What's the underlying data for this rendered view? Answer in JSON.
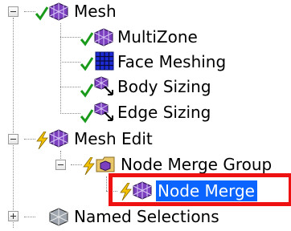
{
  "tree": {
    "mesh": {
      "label": "Mesh",
      "icon": "mesh-icon",
      "status": "check-icon",
      "expanded": true
    },
    "multizone": {
      "label": "MultiZone",
      "icon": "multizone-icon",
      "status": "check-icon"
    },
    "face_meshing": {
      "label": "Face Meshing",
      "icon": "face-meshing-icon",
      "status": "check-icon"
    },
    "body_sizing": {
      "label": "Body Sizing",
      "icon": "body-sizing-icon",
      "status": "check-icon"
    },
    "edge_sizing": {
      "label": "Edge Sizing",
      "icon": "edge-sizing-icon",
      "status": "check-icon"
    },
    "mesh_edit": {
      "label": "Mesh Edit",
      "icon": "mesh-edit-icon",
      "status": "lightning-icon",
      "expanded": true
    },
    "node_merge_group": {
      "label": "Node Merge Group",
      "icon": "node-merge-group-icon",
      "status": "lightning-icon",
      "expanded": true
    },
    "node_merge": {
      "label": "Node Merge",
      "icon": "node-merge-icon",
      "status": "lightning-icon",
      "selected": true
    },
    "named_selections": {
      "label": "Named Selections",
      "icon": "named-selections-icon",
      "expanded": false
    }
  },
  "colors": {
    "selection": "#0a64ff",
    "highlight_box": "#ee1111",
    "check": "#1a9a1a",
    "lightning": "#f2c200",
    "mesh_purple": "#6a2ea8",
    "grid_blue": "#1c2bd6"
  }
}
